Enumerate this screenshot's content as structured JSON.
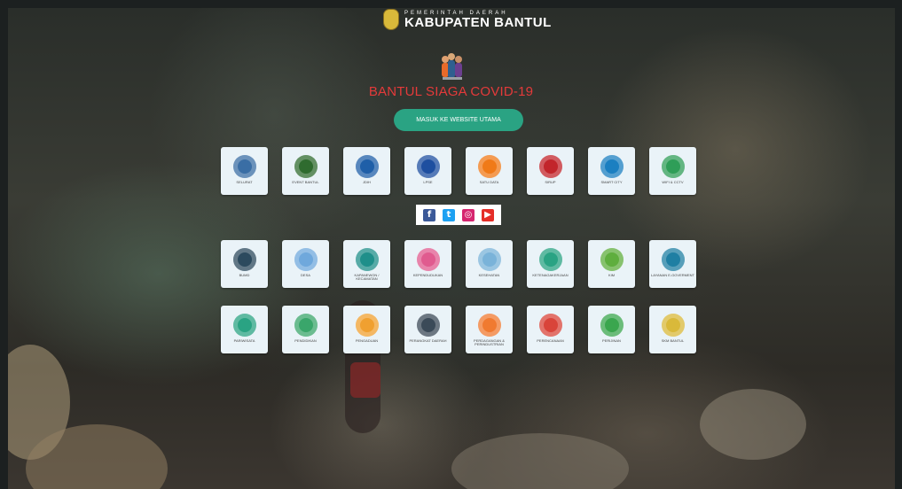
{
  "header": {
    "logo_small": "PEMERINTAH DAERAH",
    "logo_big": "KABUPATEN BANTUL"
  },
  "covid_title": "BANTUL SIAGA COVID-19",
  "main_button": "MASUK KE WEBSITE UTAMA",
  "row1": [
    {
      "label": "SELURAT",
      "icon": "selurat-icon",
      "color": "#3a6ea5"
    },
    {
      "label": "EVENT BANTUL",
      "icon": "bantul-events-icon",
      "color": "#2f6b2f"
    },
    {
      "label": "JDIH",
      "icon": "jdih-globe-icon",
      "color": "#1f5fa8"
    },
    {
      "label": "LPSE",
      "icon": "lpse-icon",
      "color": "#1e4fa0"
    },
    {
      "label": "SATU DATA",
      "icon": "satu-data-icon",
      "color": "#f07a18"
    },
    {
      "label": "SIRUP",
      "icon": "sirup-icon",
      "color": "#c2252b"
    },
    {
      "label": "SMART CITY",
      "icon": "smart-city-icon",
      "color": "#1b7fc1"
    },
    {
      "label": "WIFI & CCTV",
      "icon": "wifi-cctv-icon",
      "color": "#2f9e58"
    }
  ],
  "social": [
    {
      "name": "facebook-icon",
      "glyph": "f",
      "color": "#3b5998"
    },
    {
      "name": "twitter-icon",
      "glyph": "t",
      "color": "#1da1f2"
    },
    {
      "name": "instagram-icon",
      "glyph": "◎",
      "color": "#d6266f"
    },
    {
      "name": "youtube-icon",
      "glyph": "▶",
      "color": "#e52d27"
    }
  ],
  "row2": [
    {
      "label": "BUMD",
      "icon": "bumd-icon",
      "color": "#2c4a5e"
    },
    {
      "label": "DESA",
      "icon": "desa-icon",
      "color": "#6fa8dc"
    },
    {
      "label": "KAPANEWON / KECAMATAN",
      "icon": "kapanewon-icon",
      "color": "#1f8f8a"
    },
    {
      "label": "KEPENDUDUKAN",
      "icon": "kependudukan-icon",
      "color": "#e05b8f"
    },
    {
      "label": "KESEHATAN",
      "icon": "kesehatan-icon",
      "color": "#7ab3d9"
    },
    {
      "label": "KETENAGAKERJAAN",
      "icon": "ketenagakerjaan-icon",
      "color": "#2aa383"
    },
    {
      "label": "KIM",
      "icon": "kim-icon",
      "color": "#5fae3e"
    },
    {
      "label": "LAYANAN E-GOVERMENT",
      "icon": "e-government-icon",
      "color": "#1f7fa3"
    }
  ],
  "row3": [
    {
      "label": "PARIWISATA",
      "icon": "pariwisata-icon",
      "color": "#2aa383"
    },
    {
      "label": "PENDIDIKAN",
      "icon": "pendidikan-icon",
      "color": "#3aa66b"
    },
    {
      "label": "PENGADUAN",
      "icon": "pengaduan-icon",
      "color": "#f0a030"
    },
    {
      "label": "PERANGKAT DAERAH",
      "icon": "perangkat-daerah-icon",
      "color": "#3b4a58"
    },
    {
      "label": "PERDAGANGAN & PERINDUSTRIAN",
      "icon": "perdagangan-icon",
      "color": "#f07a30"
    },
    {
      "label": "PERENCANAAN",
      "icon": "perencanaan-icon",
      "color": "#d9443a"
    },
    {
      "label": "PERIJINAN",
      "icon": "perijinan-icon",
      "color": "#3aa64e"
    },
    {
      "label": "SKM BANTUL",
      "icon": "skm-bantul-icon",
      "color": "#d9b93a"
    }
  ]
}
